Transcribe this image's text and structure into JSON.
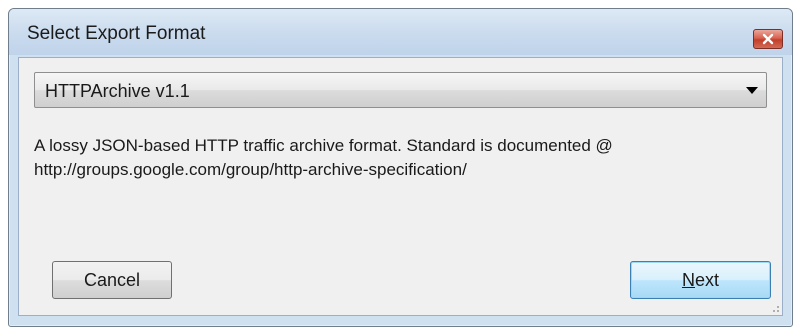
{
  "window": {
    "title": "Select Export Format",
    "close_icon": "close-icon"
  },
  "format_select": {
    "selected": "HTTPArchive v1.1",
    "arrow_icon": "dropdown-arrow-icon"
  },
  "description": {
    "line1": "A lossy JSON-based HTTP traffic archive format. Standard is documented @",
    "line2": "http://groups.google.com/group/http-archive-specification/"
  },
  "buttons": {
    "cancel": "Cancel",
    "next_mnemonic": "N",
    "next_rest": "ext"
  },
  "colors": {
    "title_bar": "#cadbee",
    "close_button": "#c13f2a",
    "default_button_border": "#3c7fb1",
    "client_background": "#f0f0f0"
  }
}
